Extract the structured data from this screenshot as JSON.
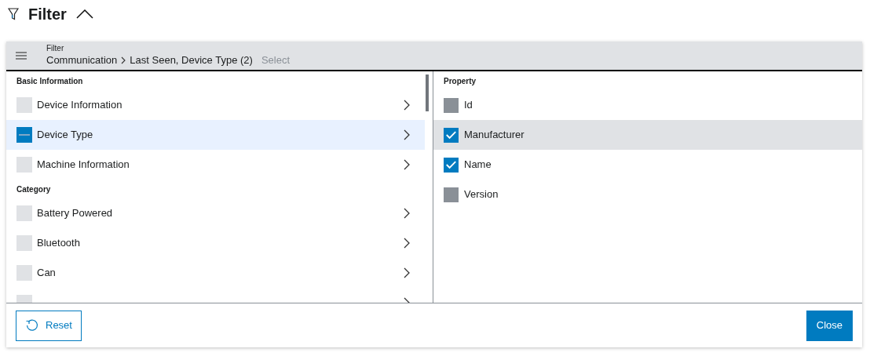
{
  "title": "Filter",
  "expanded": true,
  "breadcrumb": {
    "label": "Filter",
    "path": "Communication",
    "current": "Last Seen, Device Type (2)",
    "placeholder": "Select"
  },
  "left_groups": [
    {
      "heading": "Basic Information",
      "items": [
        {
          "label": "Device Information",
          "checked": false,
          "indeterminate": false,
          "selected": false
        },
        {
          "label": "Device Type",
          "checked": true,
          "indeterminate": true,
          "selected": true
        },
        {
          "label": "Machine Information",
          "checked": false,
          "indeterminate": false,
          "selected": false
        }
      ]
    },
    {
      "heading": "Category",
      "items": [
        {
          "label": "Battery Powered",
          "checked": false,
          "indeterminate": false,
          "selected": false
        },
        {
          "label": "Bluetooth",
          "checked": false,
          "indeterminate": false,
          "selected": false
        },
        {
          "label": "Can",
          "checked": false,
          "indeterminate": false,
          "selected": false
        },
        {
          "selected": false
        }
      ]
    }
  ],
  "property": {
    "heading": "Property",
    "items": [
      {
        "label": "Id",
        "checked": false,
        "hovered": false
      },
      {
        "label": "Manufacturer",
        "checked": true,
        "hovered": true
      },
      {
        "label": "Name",
        "checked": true,
        "hovered": false
      },
      {
        "label": "Version",
        "checked": false,
        "hovered": false
      }
    ]
  },
  "buttons": {
    "reset": "Reset",
    "close": "Close"
  }
}
